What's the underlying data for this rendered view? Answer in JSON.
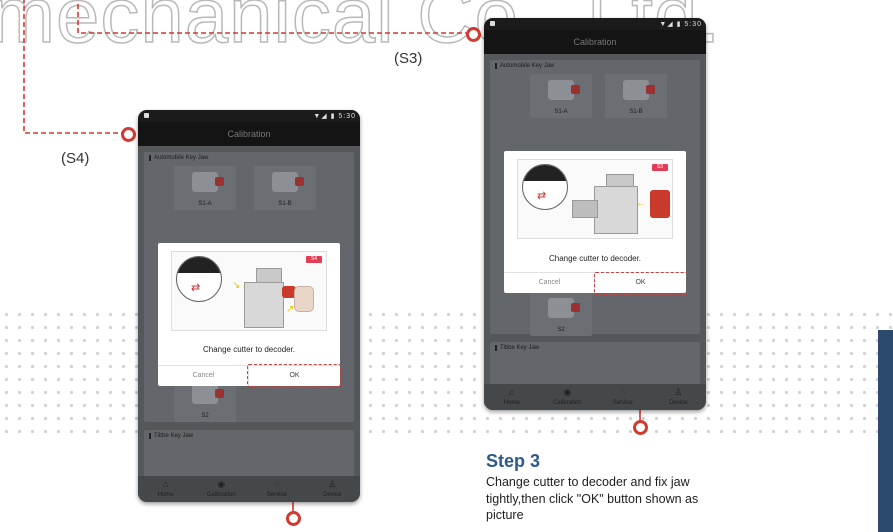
{
  "watermark": {
    "text": "mechanical Co., Ltd."
  },
  "labels": {
    "s3": "(S3)",
    "s4": "(S4)"
  },
  "phone": {
    "status_time": "5:30",
    "status_signal": "▼◢ ▮",
    "title": "Calibration",
    "section_automobile": "Automobile Key Jaw",
    "section_tibbe": "Tibbe Key Jaw",
    "tile_s1a": "S1-A",
    "tile_s1b": "S1-B",
    "tile_s2": "S2",
    "nav": [
      "Home",
      "Calibration",
      "Service",
      "Device"
    ]
  },
  "dialog": {
    "message": "Change cutter to decoder.",
    "cancel": "Cancel",
    "ok": "OK",
    "badge_s4": "S4",
    "badge_s3": "S3"
  },
  "step": {
    "heading": "Step 3",
    "description": "Change cutter to decoder and fix jaw tightly,then click \"OK\" button shown as picture"
  },
  "colors": {
    "accent_red": "#d13a30",
    "step_blue": "#2d5a8a",
    "panel_navy": "#2c4a6e"
  },
  "icons": {
    "nav": [
      "home-icon",
      "calibration-icon",
      "service-icon",
      "device-icon"
    ]
  }
}
